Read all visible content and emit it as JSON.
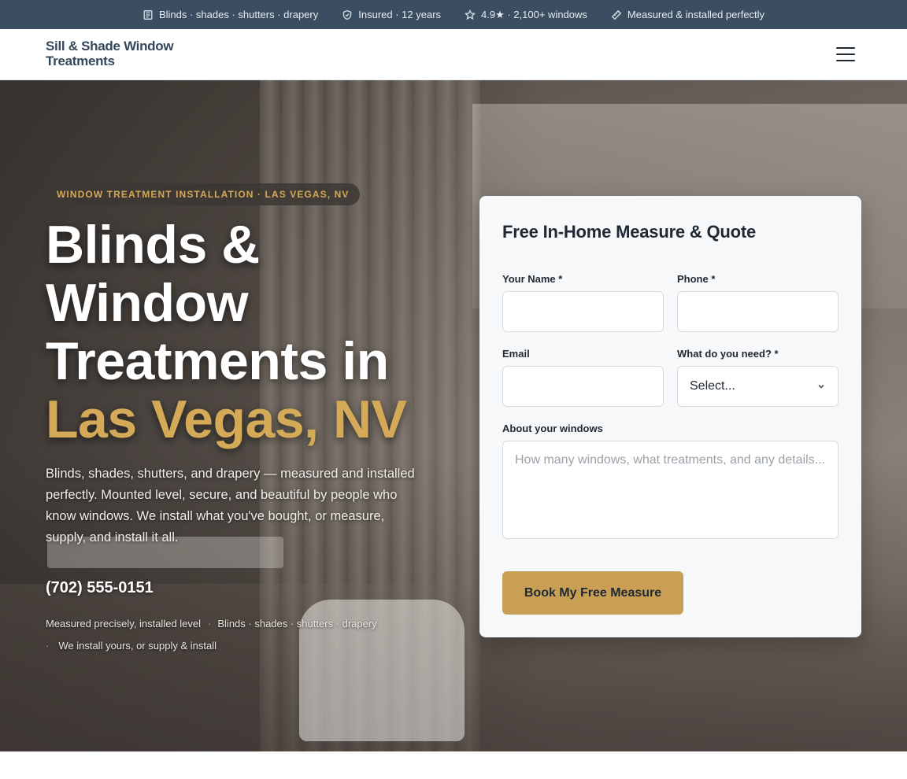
{
  "topbar": {
    "items": [
      {
        "icon": "list-icon",
        "text": "Blinds · shades · shutters · drapery"
      },
      {
        "icon": "shield-icon",
        "text": "Insured · 12 years"
      },
      {
        "icon": "star-icon",
        "text": "4.9★ · 2,100+ windows"
      },
      {
        "icon": "ruler-icon",
        "text": "Measured & installed perfectly"
      }
    ]
  },
  "header": {
    "logo": "Sill & Shade Window Treatments",
    "menu_icon": "hamburger-menu-icon"
  },
  "hero": {
    "badge": "WINDOW TREATMENT INSTALLATION · LAS VEGAS, NV",
    "headline_line1": "Blinds &",
    "headline_line2": "Window",
    "headline_line3": "Treatments in",
    "headline_accent": "Las Vegas, NV",
    "subcopy": "Blinds, shades, shutters, and drapery — measured and installed perfectly. Mounted level, secure, and beautiful by people who know windows. We install what you've bought, or measure, supply, and install it all.",
    "phone": "(702) 555-0151",
    "features": [
      "Measured precisely, installed level",
      "Blinds · shades · shutters · drapery",
      "We install yours, or supply & install"
    ],
    "separator": "·"
  },
  "form": {
    "title": "Free In-Home Measure & Quote",
    "name_label": "Your Name *",
    "name_value": "",
    "phone_label": "Phone *",
    "phone_value": "",
    "email_label": "Email",
    "email_value": "",
    "need_label": "What do you need? *",
    "need_selected": "Select...",
    "about_label": "About your windows",
    "about_placeholder": "How many windows, what treatments, and any details...",
    "submit_label": "Book My Free Measure"
  },
  "colors": {
    "topbar_bg": "#3b4d60",
    "accent_gold": "#d4a957",
    "button_gold": "#c99f55",
    "logo_text": "#34475b"
  }
}
